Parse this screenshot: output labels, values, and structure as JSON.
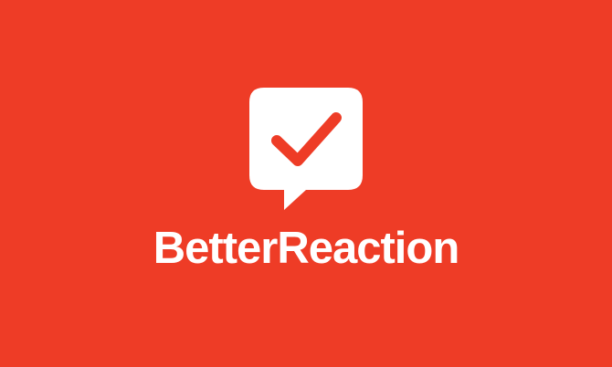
{
  "brand": {
    "name": "BetterReaction",
    "background_color": "#EE3C26",
    "foreground_color": "#FFFFFF",
    "icon": "speech-bubble-checkmark-icon"
  }
}
